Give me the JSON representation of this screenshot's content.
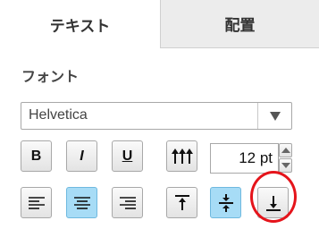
{
  "tabs": {
    "text": "テキスト",
    "arrange": "配置"
  },
  "font": {
    "section_label": "フォント",
    "family": "Helvetica"
  },
  "style": {
    "bold": "B",
    "italic": "I",
    "underline": "U"
  },
  "size": {
    "value": "12 pt"
  },
  "alignment": {
    "selected": "center"
  },
  "vertical_alignment": {
    "selected": "middle"
  },
  "colors": {
    "active_button": "#a7dcf6",
    "highlight_ring": "#e5141b"
  }
}
